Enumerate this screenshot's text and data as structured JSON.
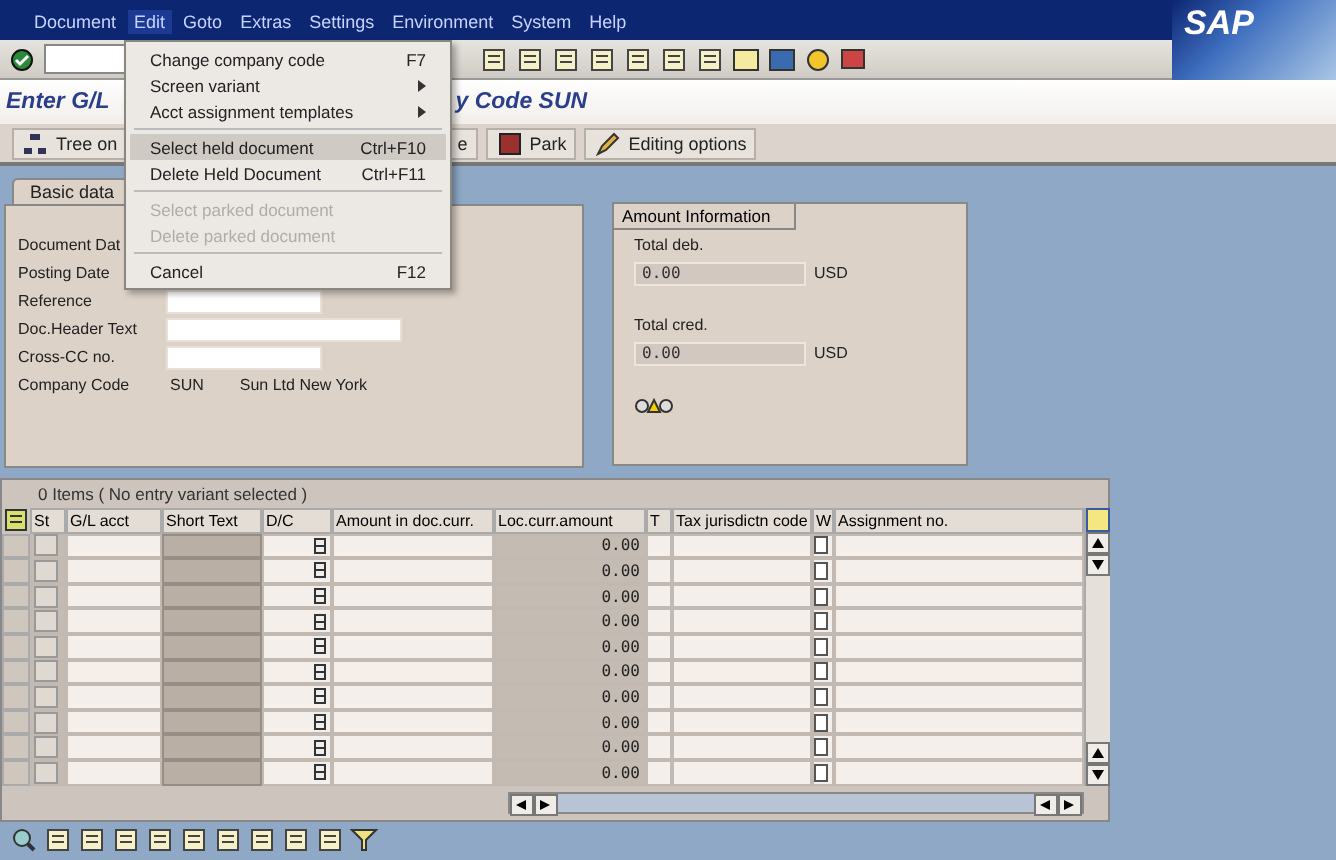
{
  "menu_bar": [
    {
      "label": "Document",
      "selected": false
    },
    {
      "label": "Edit",
      "selected": true
    },
    {
      "label": "Goto",
      "selected": false
    },
    {
      "label": "Extras",
      "selected": false
    },
    {
      "label": "Settings",
      "selected": false
    },
    {
      "label": "Environment",
      "selected": false
    },
    {
      "label": "System",
      "selected": false
    },
    {
      "label": "Help",
      "selected": false
    }
  ],
  "logo": "SAP",
  "edit_menu": [
    {
      "kind": "entry",
      "label": "Change company code",
      "shortcut": "F7",
      "selected": false,
      "disabled": false
    },
    {
      "kind": "entry",
      "label": "Screen variant",
      "submenu": true,
      "selected": false,
      "disabled": false
    },
    {
      "kind": "entry",
      "label": "Acct assignment templates",
      "submenu": true,
      "selected": false,
      "disabled": false
    },
    {
      "kind": "separator"
    },
    {
      "kind": "entry",
      "label": "Select held document",
      "shortcut": "Ctrl+F10",
      "selected": true,
      "disabled": false
    },
    {
      "kind": "entry",
      "label": "Delete Held Document",
      "shortcut": "Ctrl+F11",
      "selected": false,
      "disabled": false
    },
    {
      "kind": "separator"
    },
    {
      "kind": "entry",
      "label": "Select parked document",
      "submenu": false,
      "selected": false,
      "disabled": true
    },
    {
      "kind": "entry",
      "label": "Delete parked document",
      "submenu": false,
      "selected": false,
      "disabled": true
    },
    {
      "kind": "separator"
    },
    {
      "kind": "entry",
      "label": "Cancel",
      "shortcut": "F12",
      "selected": false,
      "disabled": false
    }
  ],
  "title": {
    "left": "Enter G/L",
    "right": "y Code SUN"
  },
  "app_toolbar": [
    {
      "kind": "tree",
      "label": "Tree on"
    },
    {
      "kind": "plain",
      "label": "e"
    },
    {
      "kind": "park",
      "label": "Park"
    },
    {
      "kind": "edit",
      "label": "Editing options"
    }
  ],
  "basic_tab": {
    "label": "Basic data",
    "selected": true
  },
  "header_fields": [
    {
      "kind": "label",
      "label": "Document Dat"
    },
    {
      "kind": "label",
      "label": "Posting Date"
    },
    {
      "kind": "input",
      "label": "Reference",
      "wide": false
    },
    {
      "kind": "input",
      "label": "Doc.Header Text",
      "wide": true
    },
    {
      "kind": "input",
      "label": "Cross-CC no.",
      "wide": false
    },
    {
      "kind": "text",
      "label": "Company Code",
      "code": "SUN",
      "name": "Sun Ltd New York"
    }
  ],
  "amount_info": {
    "title": "Amount Information",
    "debit_label": "Total deb.",
    "debit": "0.00",
    "debit_currency": "USD",
    "credit_label": "Total cred.",
    "credit": "0.00",
    "credit_currency": "USD"
  },
  "items": {
    "summary": "0 Items ( No entry variant selected )",
    "columns": [
      "St",
      "G/L acct",
      "Short Text",
      "D/C",
      "Amount in doc.curr.",
      "Loc.curr.amount",
      "T",
      "Tax jurisdictn code",
      "W",
      "Assignment no."
    ],
    "rows": [
      {
        "loc_amount": "0.00"
      },
      {
        "loc_amount": "0.00"
      },
      {
        "loc_amount": "0.00"
      },
      {
        "loc_amount": "0.00"
      },
      {
        "loc_amount": "0.00"
      },
      {
        "loc_amount": "0.00"
      },
      {
        "loc_amount": "0.00"
      },
      {
        "loc_amount": "0.00"
      },
      {
        "loc_amount": "0.00"
      },
      {
        "loc_amount": "0.00"
      }
    ]
  }
}
